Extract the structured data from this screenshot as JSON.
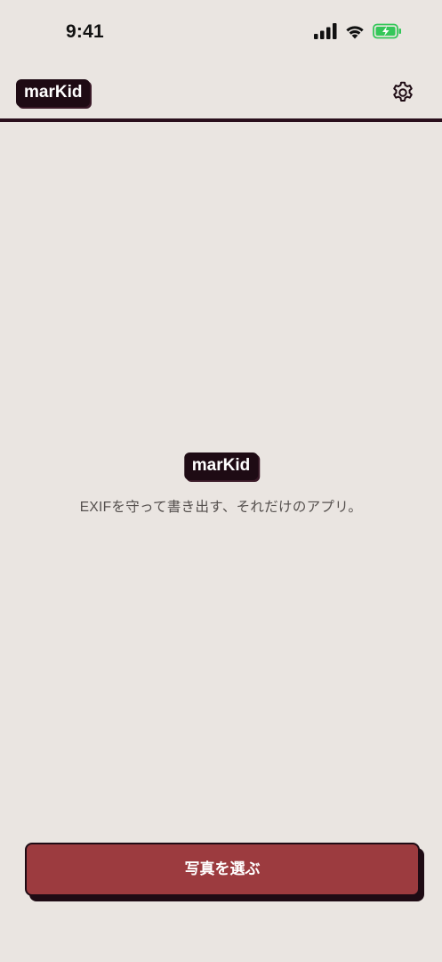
{
  "status_bar": {
    "time": "9:41",
    "icons": [
      "cellular-signal-icon",
      "wifi-icon",
      "battery-charging-icon"
    ],
    "battery_color": "#34c759"
  },
  "header": {
    "logo_text": "marKid",
    "settings_icon": "gear-icon"
  },
  "main": {
    "logo_text": "marKid",
    "tagline": "EXIFを守って書き出す、それだけのアプリ。"
  },
  "actions": {
    "primary_label": "写真を選ぶ"
  },
  "colors": {
    "background": "#eae5e1",
    "dark": "#1e0b14",
    "accent": "#9c3b3f"
  }
}
